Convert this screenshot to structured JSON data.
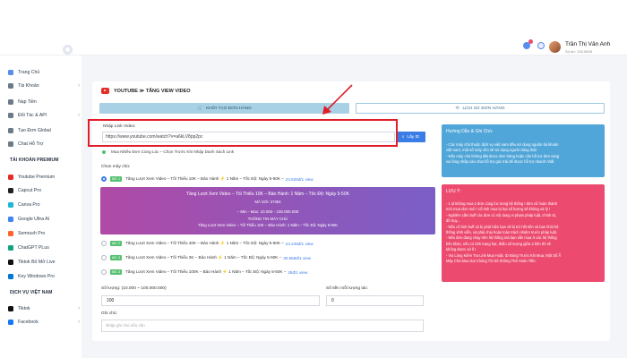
{
  "header": {
    "user_name": "Trần Thị Vân Anh",
    "balance": "Số dư: 100.000đ"
  },
  "sidebar": {
    "items": [
      {
        "label": "Trang Chủ",
        "icon": "home-icon",
        "color": "#5b8def",
        "chevron": false
      },
      {
        "label": "Tài Khoản",
        "icon": "user-icon",
        "color": "#6c7a89",
        "chevron": true
      },
      {
        "label": "Nạp Tiền",
        "icon": "wallet-icon",
        "color": "#6c7a89",
        "chevron": false
      },
      {
        "label": "Đối Tác & API",
        "icon": "handshake-icon",
        "color": "#6c7a89",
        "chevron": true
      },
      {
        "label": "Tạo Đơn Global",
        "icon": "globe-icon",
        "color": "#6c7a89",
        "chevron": false
      },
      {
        "label": "Chat Hỗ Trợ",
        "icon": "chat-icon",
        "color": "#6c7a89",
        "chevron": false
      }
    ],
    "premium_section": "TÀI KHOẢN PREMIUM",
    "premium_items": [
      {
        "label": "Youtube Premium",
        "icon": "youtube-icon",
        "color": "#e52d27"
      },
      {
        "label": "Capcut Pro",
        "icon": "capcut-icon",
        "color": "#222222"
      },
      {
        "label": "Canva Pro",
        "icon": "canva-icon",
        "color": "#1fb6d8"
      },
      {
        "label": "Google Ultra AI",
        "icon": "google-icon",
        "color": "#4285f4"
      },
      {
        "label": "Semrush Pro",
        "icon": "semrush-icon",
        "color": "#ff642d"
      },
      {
        "label": "ChatGPT PLus",
        "icon": "chatgpt-icon",
        "color": "#10a37f"
      },
      {
        "label": "Tiktok Bỏ Mở Live",
        "icon": "tiktok-icon",
        "color": "#111111"
      },
      {
        "label": "Key Windows Pro",
        "icon": "windows-icon",
        "color": "#0078d4"
      }
    ],
    "vn_section": "DỊCH VỤ VIỆT NAM",
    "vn_items": [
      {
        "label": "Tiktok",
        "icon": "tiktok-icon",
        "color": "#111111"
      },
      {
        "label": "Facebook",
        "icon": "facebook-icon",
        "color": "#1877f2"
      }
    ]
  },
  "main": {
    "title": "YOUTUBE ≫ TĂNG VIEW VIDEO",
    "tabs": {
      "create": "KHỞI TẠO ĐƠN HÀNG",
      "history": "LỊCH SỬ ĐƠN HÀNG"
    },
    "link_label": "Nhập Link Video:",
    "link_value": "https://www.youtube.com/watch?v=a6kLV8pp2pc",
    "get_id_button": "Lấy ID",
    "hint": "Mua Nhiều Đơn Cùng Lúc – Chọn Trước Khi Nhập Danh Sách Link",
    "server_title": "Chọn máy chủ:",
    "servers": [
      {
        "badge": "MC 1",
        "name": "Tăng Lượt Xem Video – Tối Thiểu 10K – Bảo Hành ⚡ 1 Năm – Tốc Độ: Ngày 5-50K –",
        "price": "24.625đ/1 view",
        "selected": true
      },
      {
        "badge": "MC 2",
        "name": "Tăng Lượt Xem Video – Tối Thiểu 40K – Bảo Hành ⚡ 1 Năm – Tốc Độ: Ngày 5-50K –",
        "price": "24.248đ/1 view",
        "selected": false
      },
      {
        "badge": "MC 3",
        "name": "Tăng Lượt Xem Video – Tối Thiểu 3K – Bảo Hành ⚡ 1 Năm – Tốc Độ: Ngày 5-50K –",
        "price": "30.558đ/1 view",
        "selected": false
      },
      {
        "badge": "MC 4",
        "name": "Tăng Lượt Xem Video – Tối Thiểu 100K – Bảo Hành ⚡ 1 Năm – Tốc Độ: Ngày 5-50K –",
        "price": "25đ/1 view",
        "selected": false
      }
    ],
    "promo": {
      "line1": "Tăng Lượt Xem Video – Tối Thiểu 10K – Bảo Hành: 1 Năm – Tốc Độ: Ngày 5-50K",
      "line2": "MÃ GÓI: 37484",
      "line3": "– Min - Max: 10.000 - 100.000.000",
      "line4": "THÔNG TIN MÁY CHỦ",
      "line5": "Tăng Lượt Xem Video – Tối Thiểu 10K – Bảo Hành: 1 Năm – Tốc Độ: Ngày 5-50K"
    },
    "quantity_label": "Số lượng: (10.000 ~ 100.000.000)",
    "quantity_value": "100",
    "total_label": "Số tiền mỗi lượng tác:",
    "total_value": "0",
    "note_label": "Ghi chú:",
    "note_placeholder": "Nhập ghi chú nếu cần"
  },
  "guide": {
    "title": "Hướng Dẫn & Ghi Chú:",
    "lines": [
      "- Các máy chủ thuộc dịch vụ việt nam đều sử dụng nguồn tài khoản",
      "việt nam, một số máy chủ sẽ sử dụng người dùng thật",
      "- Nếu máy chủ không đặt được đơn hàng hoặc cần hỗ trợ đơn vàng",
      "vui lòng nhắp vào chat hỗ trợ góc trái để được hỗ trợ nhanh nhất"
    ]
  },
  "notice": {
    "title": "LƯU Ý:",
    "lines": [
      "- 1 id không mua 2 đơn cùng lúc trong hệ thống ! đơn cũ hoàn thành",
      "mới mua đơn mới ! cố tình mua bị hụt số lượng sẽ không xử lý !",
      "- Nghiêm cấm buff các đơn có nội dung vi phạm pháp luật, chính trị,",
      "đồ trụy...",
      "- Nếu cố tình buff và bị phát hiện bạn sẽ bị trừ hết tiền và ban khỏi hệ",
      "thống vĩnh viễn, và phải chịu hoàn toàn trách nhiệm trước pháp luật.",
      "- Nếu đơn đang chạy trên hệ thống mà bạn vẫn mua ở các hệ thống",
      "bên khác, nếu có tình trạng hụt, thiếu số lượng giữa 2 bên thì sẽ",
      "không được xử lí !",
      "- Vui Lòng Kiểm Tra Link Mua Hoặc ID Đúng Trước Khi Mua, Một Số Ẩ",
      "Máy Chủ Mua Sai Chúng Tôi Sẽ Không Thể Hoàn Tiền."
    ]
  }
}
